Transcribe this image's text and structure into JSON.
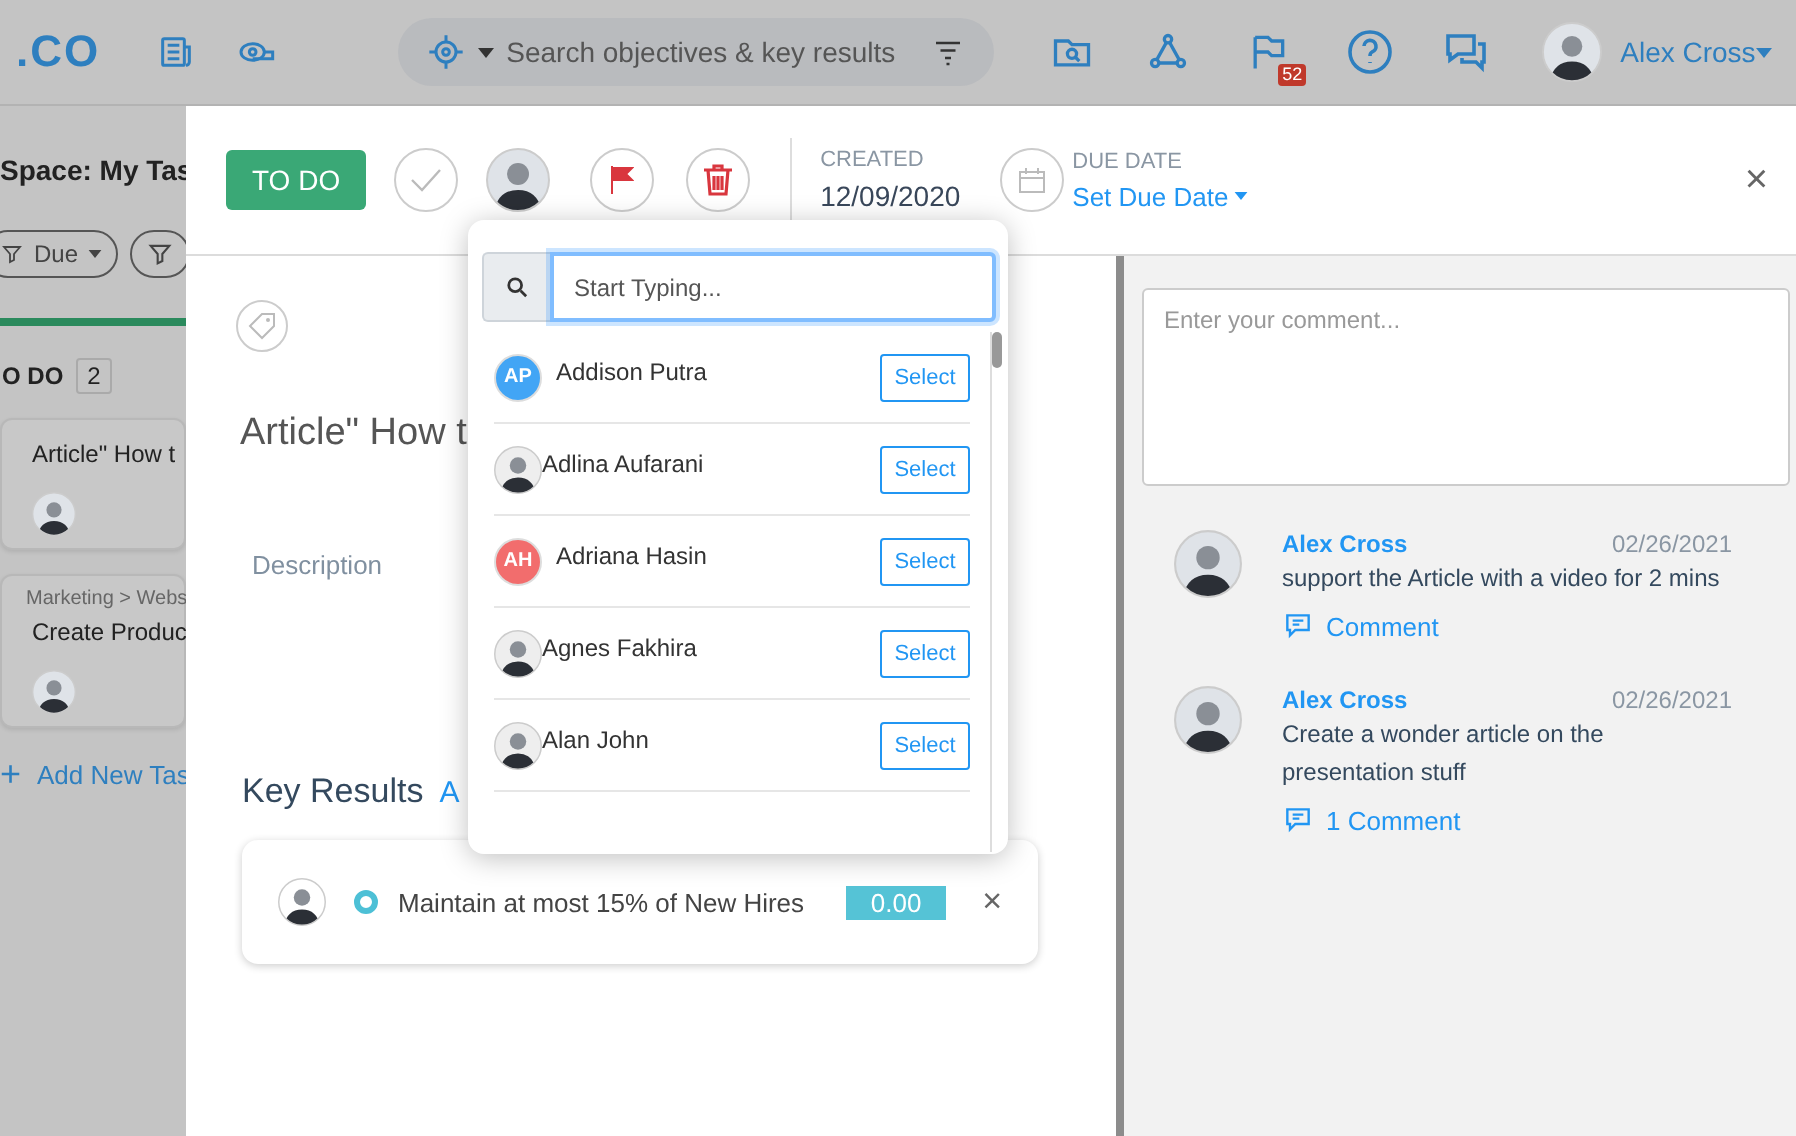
{
  "topbar": {
    "logo": ".CO",
    "search": {
      "placeholder": "Search objectives & key results"
    },
    "notifications_badge": "52",
    "user": "Alex Cross"
  },
  "board": {
    "space_title": "Space: My Tas",
    "filter_label": "Due",
    "column": {
      "title": "O DO",
      "count": "2"
    },
    "cards": [
      {
        "title": "Article\" How t"
      },
      {
        "breadcrumb": "Marketing > Webs",
        "title": "Create Produc"
      }
    ],
    "add_task": {
      "icon": "+",
      "label": "Add New Tas"
    }
  },
  "task": {
    "status_button": "TO DO",
    "created_label": "CREATED",
    "created_date": "12/09/2020",
    "due_label": "DUE DATE",
    "due_value": "Set Due Date",
    "title": "Article\" How t",
    "description_label": "Description",
    "key_results_title": "Key Results",
    "key_results_link": "A",
    "key_results": [
      {
        "text": "Maintain at most 15% of New Hires",
        "value": "0.00"
      }
    ],
    "close": "×"
  },
  "comments": {
    "placeholder": "Enter your comment...",
    "items": [
      {
        "author": "Alex Cross",
        "date": "02/26/2021",
        "text": "support the Article with a video for 2 mins",
        "action": "Comment"
      },
      {
        "author": "Alex Cross",
        "date": "02/26/2021",
        "text": "Create a wonder article on the presentation stuff",
        "action": "1 Comment"
      }
    ]
  },
  "assignee_dropdown": {
    "placeholder": "Start Typing...",
    "people": [
      {
        "name": "Addison Putra",
        "kind": "initials",
        "initials": "AP",
        "color": "#42a5f5",
        "button": "Select"
      },
      {
        "name": "Adlina Aufarani",
        "kind": "photo",
        "button": "Select"
      },
      {
        "name": "Adriana Hasin",
        "kind": "initials",
        "initials": "AH",
        "color": "#f26d6d",
        "button": "Select"
      },
      {
        "name": "Agnes Fakhira",
        "kind": "photo",
        "button": "Select"
      },
      {
        "name": "Alan John",
        "kind": "photo",
        "button": "Select"
      }
    ]
  }
}
